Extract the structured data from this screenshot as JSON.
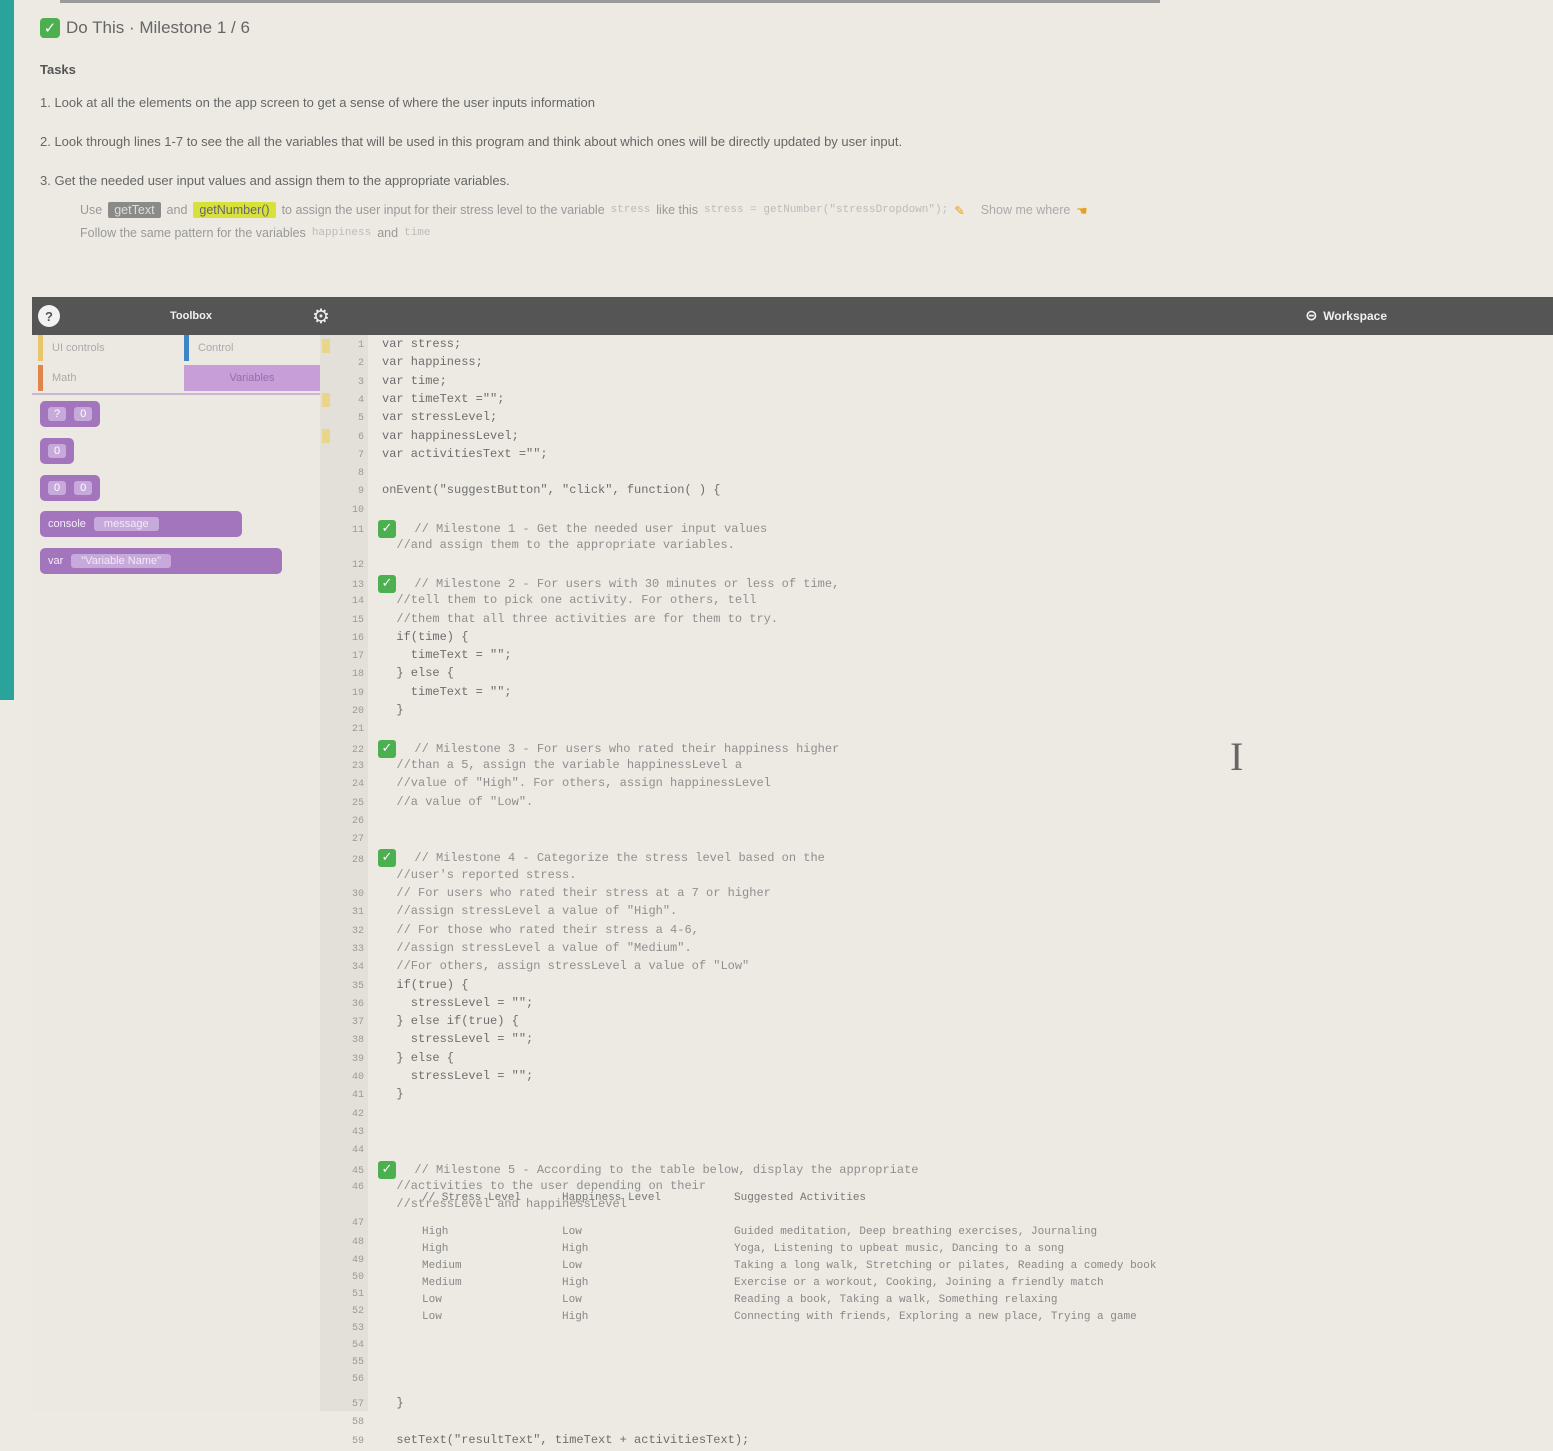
{
  "header": {
    "title": "Do This · Milestone 1 / 6",
    "tasks_heading": "Tasks",
    "tasks": [
      "1. Look at all the elements on the app screen to get a sense of where the user inputs information",
      "2. Look through lines 1-7 to see the all the variables that will be used in this program and think about which ones will be directly updated by user input.",
      "3. Get the needed user input values and assign them to the appropriate variables."
    ],
    "sub_tasks": {
      "use_prefix": "Use",
      "use_chip_1": "getText",
      "use_and": "and",
      "use_chip_2": "getNumber()",
      "use_text": "to assign the user input for their stress level to the variable",
      "use_var": "stress",
      "use_like": "like this",
      "use_code": "stress = getNumber(\"stressDropdown\");",
      "show_me": "Show me where",
      "follow_prefix": "Follow the same pattern for the variables",
      "follow_var1": "happiness",
      "follow_and": "and",
      "follow_var2": "time"
    }
  },
  "toolbar": {
    "help": "?",
    "toolbox_label": "Toolbox",
    "workspace_label": "Workspace"
  },
  "toolbox": {
    "categories": [
      "UI controls",
      "Control",
      "Math",
      "Variables"
    ],
    "blocks": {
      "b1_left": "?",
      "b1_right": "0",
      "b2": "0",
      "b3_left": "0",
      "b3_right": "0",
      "b4_left": "console",
      "b4_right": "message",
      "b5_left": "var",
      "b5_right": "\"Variable Name\""
    }
  },
  "code": [
    {
      "n": "1",
      "t": "var stress;"
    },
    {
      "n": "2",
      "t": "var happiness;"
    },
    {
      "n": "3",
      "t": "var time;"
    },
    {
      "n": "4",
      "t": "var timeText =\"\";"
    },
    {
      "n": "5",
      "t": "var stressLevel;"
    },
    {
      "n": "6",
      "t": "var happinessLevel;"
    },
    {
      "n": "7",
      "t": "var activitiesText =\"\";"
    },
    {
      "n": "8",
      "t": ""
    },
    {
      "n": "9",
      "t": "onEvent(\"suggestButton\", \"click\", function( ) {"
    },
    {
      "n": "10",
      "t": ""
    },
    {
      "n": "11",
      "t": "  // Milestone 1 - Get the needed user input values",
      "c": true,
      "chk": true
    },
    {
      "n": "",
      "t": "  //and assign them to the appropriate variables.",
      "c": true
    },
    {
      "n": "12",
      "t": ""
    },
    {
      "n": "13",
      "t": "  // Milestone 2 - For users with 30 minutes or less of time,",
      "c": true,
      "chk": true
    },
    {
      "n": "14",
      "t": "  //tell them to pick one activity. For others, tell",
      "c": true
    },
    {
      "n": "15",
      "t": "  //them that all three activities are for them to try.",
      "c": true
    },
    {
      "n": "16",
      "t": "  if(time) {"
    },
    {
      "n": "17",
      "t": "    timeText = \"\";"
    },
    {
      "n": "18",
      "t": "  } else {"
    },
    {
      "n": "19",
      "t": "    timeText = \"\";"
    },
    {
      "n": "20",
      "t": "  }"
    },
    {
      "n": "21",
      "t": ""
    },
    {
      "n": "22",
      "t": "  // Milestone 3 - For users who rated their happiness higher",
      "c": true,
      "chk": true
    },
    {
      "n": "23",
      "t": "  //than a 5, assign the variable happinessLevel a",
      "c": true
    },
    {
      "n": "24",
      "t": "  //value of \"High\". For others, assign happinessLevel",
      "c": true
    },
    {
      "n": "25",
      "t": "  //a value of \"Low\".",
      "c": true
    },
    {
      "n": "26",
      "t": ""
    },
    {
      "n": "27",
      "t": ""
    },
    {
      "n": "28",
      "t": "  // Milestone 4 - Categorize the stress level based on the",
      "c": true,
      "chk": true
    },
    {
      "n": "",
      "t": "  //user's reported stress.",
      "c": true
    },
    {
      "n": "30",
      "t": "  // For users who rated their stress at a 7 or higher",
      "c": true
    },
    {
      "n": "31",
      "t": "  //assign stressLevel a value of \"High\".",
      "c": true
    },
    {
      "n": "32",
      "t": "  // For those who rated their stress a 4-6,",
      "c": true
    },
    {
      "n": "33",
      "t": "  //assign stressLevel a value of \"Medium\".",
      "c": true
    },
    {
      "n": "34",
      "t": "  //For others, assign stressLevel a value of \"Low\"",
      "c": true
    },
    {
      "n": "35",
      "t": "  if(true) {"
    },
    {
      "n": "36",
      "t": "    stressLevel = \"\";"
    },
    {
      "n": "37",
      "t": "  } else if(true) {"
    },
    {
      "n": "38",
      "t": "    stressLevel = \"\";"
    },
    {
      "n": "39",
      "t": "  } else {"
    },
    {
      "n": "40",
      "t": "    stressLevel = \"\";"
    },
    {
      "n": "41",
      "t": "  }"
    },
    {
      "n": "42",
      "t": ""
    },
    {
      "n": "43",
      "t": ""
    },
    {
      "n": "44",
      "t": ""
    },
    {
      "n": "45",
      "t": "  // Milestone 5 - According to the table below, display the appropriate",
      "c": true,
      "chk": true
    },
    {
      "n": "46",
      "t": "  //activities to the user depending on their",
      "c": true
    },
    {
      "n": "",
      "t": "  //stressLevel and happinessLevel",
      "c": true
    },
    {
      "n": "47",
      "t": ""
    },
    {
      "n": "48",
      "t": ""
    }
  ],
  "table": {
    "line_numbers": [
      "49",
      "50",
      "51",
      "52",
      "53",
      "54",
      "55",
      "56"
    ],
    "headers": [
      "// Stress Level",
      "Happiness Level",
      "Suggested Activities"
    ],
    "stress": [
      "High",
      "High",
      "Medium",
      "Medium",
      "Low",
      "Low"
    ],
    "happiness": [
      "Low",
      "High",
      "Low",
      "High",
      "Low",
      "High"
    ],
    "activities": [
      "Guided meditation, Deep breathing exercises, Journaling",
      "Yoga, Listening to upbeat music, Dancing to a song",
      "Taking a long walk, Stretching or pilates, Reading a comedy book",
      "Exercise or a workout, Cooking, Joining a friendly match",
      "Reading a book, Taking a walk, Something relaxing",
      "Connecting with friends, Exploring a new place, Trying a game"
    ]
  },
  "footer_code": [
    {
      "n": "57",
      "t": "  }"
    },
    {
      "n": "58",
      "t": ""
    },
    {
      "n": "59",
      "t": "  setText(\"resultText\", timeText + activitiesText);"
    }
  ]
}
